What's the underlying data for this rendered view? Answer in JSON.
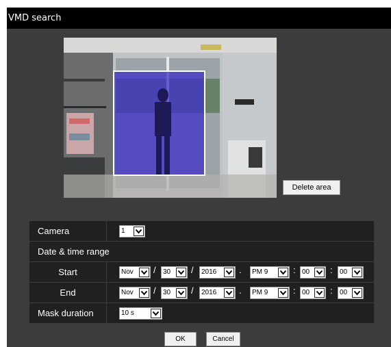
{
  "title": "VMD search",
  "delete_area_label": "Delete area",
  "form": {
    "camera_label": "Camera",
    "camera_value": "1",
    "date_range_label": "Date & time range",
    "start_label": "Start",
    "end_label": "End",
    "start": {
      "month": "Nov",
      "day": "30",
      "year": "2016",
      "ampm_hour": "PM 9",
      "minute": "00",
      "second": "00"
    },
    "end": {
      "month": "Nov",
      "day": "30",
      "year": "2016",
      "ampm_hour": "PM 9",
      "minute": "00",
      "second": "00"
    },
    "mask_label": "Mask duration",
    "mask_value": "10 s"
  },
  "buttons": {
    "ok": "OK",
    "cancel": "Cancel"
  },
  "colors": {
    "titlebar": "#000000",
    "panel": "#3c3c3c",
    "row": "#202020",
    "vmd_area": "#3c2fc8"
  },
  "icons": {
    "dropdown": "chevron-down-icon"
  }
}
